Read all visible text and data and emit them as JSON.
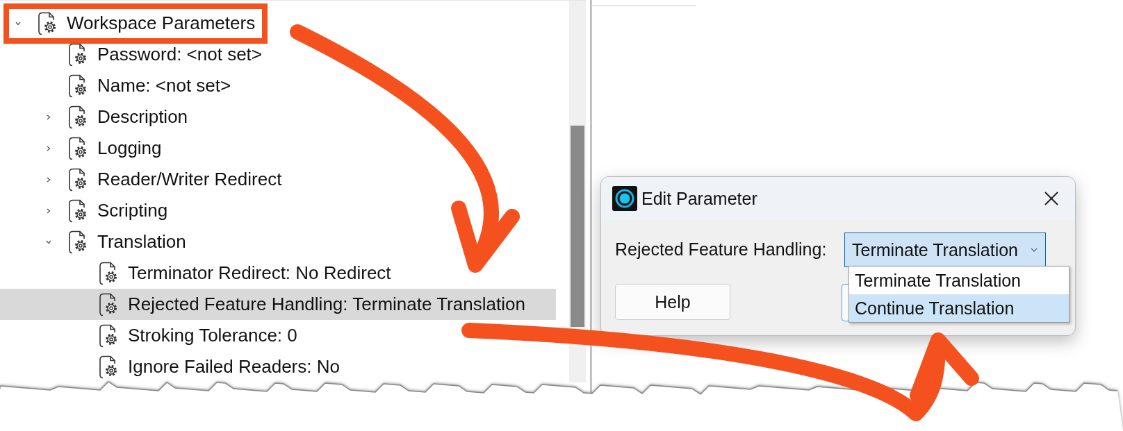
{
  "tree": {
    "items": [
      {
        "label": "Workspace Parameters",
        "expanded": true,
        "selected": false,
        "children": [
          {
            "label": "Password: <not set>",
            "selected": false
          },
          {
            "label": "Name: <not set>",
            "selected": false
          },
          {
            "label": "Description",
            "expanded": false,
            "selected": false
          },
          {
            "label": "Logging",
            "expanded": false,
            "selected": false
          },
          {
            "label": "Reader/Writer Redirect",
            "expanded": false,
            "selected": false
          },
          {
            "label": "Scripting",
            "expanded": false,
            "selected": false
          },
          {
            "label": "Translation",
            "expanded": true,
            "selected": false,
            "children": [
              {
                "label": "Terminator Redirect: No Redirect",
                "selected": false
              },
              {
                "label": "Rejected Feature Handling: Terminate Translation",
                "selected": true
              },
              {
                "label": "Stroking Tolerance: 0",
                "selected": false
              },
              {
                "label": "Ignore Failed Readers: No",
                "selected": false
              }
            ]
          }
        ]
      }
    ]
  },
  "dialog": {
    "title": "Edit Parameter",
    "field_label": "Rejected Feature Handling:",
    "value": "Terminate Translation",
    "options": [
      {
        "label": "Terminate Translation",
        "highlighted": false
      },
      {
        "label": "Continue Translation",
        "highlighted": true
      }
    ],
    "buttons": [
      "Help"
    ]
  },
  "annotations": [
    {
      "kind": "highlight-box",
      "color": "#f4511e"
    },
    {
      "kind": "arrow",
      "color": "#f4511e"
    },
    {
      "kind": "arrow",
      "color": "#f4511e"
    }
  ]
}
